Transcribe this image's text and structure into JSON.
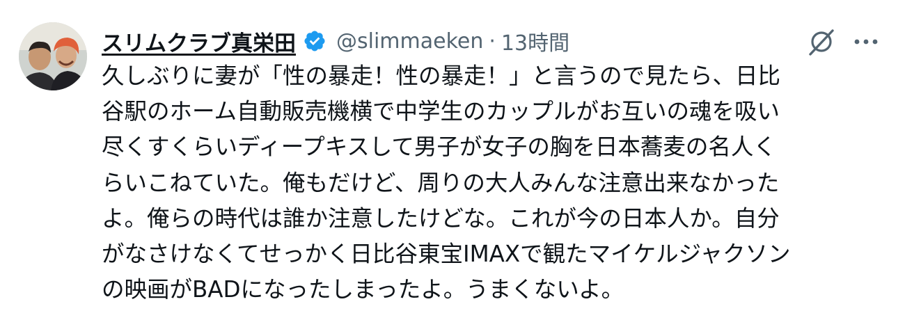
{
  "tweet": {
    "author": {
      "display_name": "スリムクラブ真栄田",
      "handle": "@slimmaeken",
      "verified": true,
      "avatar_icon": "avatar-photo"
    },
    "separator": "·",
    "timestamp": "13時間",
    "body_lines": [
      "久しぶりに妻が「性の暴走！性の暴走！」と言うので見たら、日比",
      "谷駅のホーム自動販売機横で中学生のカップルがお互いの魂を吸い",
      "尽くすくらいディープキスして男子が女子の胸を日本蕎麦の名人く",
      "らいこねていた。俺もだけど、周りの大人みんな注意出来なかった",
      "よ。俺らの時代は誰か注意したけどな。これが今の日本人か。自分",
      "がなさけなくてせっかく日比谷東宝IMAXで観たマイケルジャクソン",
      "の映画がBADになったしまったよ。うまくないよ。"
    ],
    "actions": {
      "grok_icon": "grok-icon",
      "more_icon": "more-icon"
    }
  },
  "colors": {
    "text": "#0f1419",
    "secondary": "#536471",
    "verified": "#1d9bf0"
  }
}
